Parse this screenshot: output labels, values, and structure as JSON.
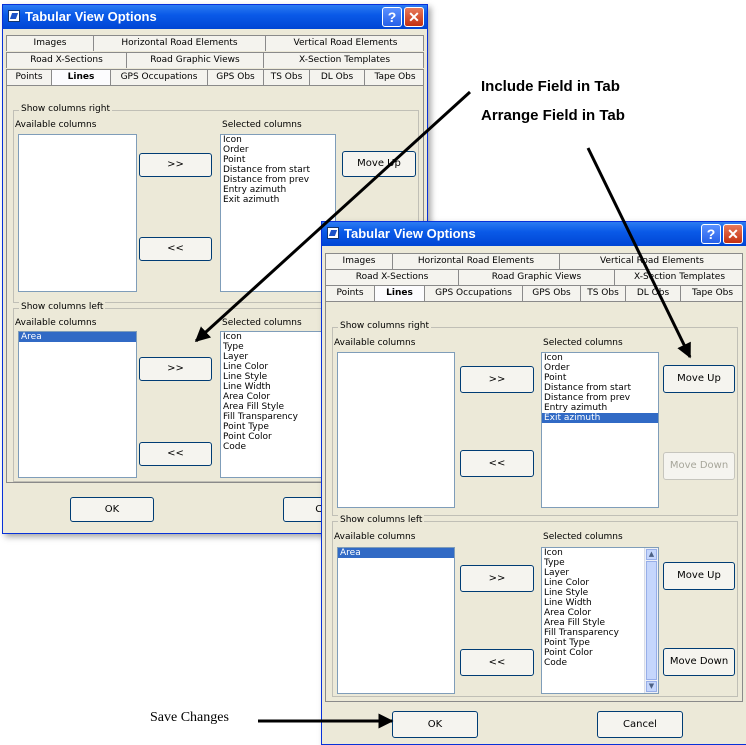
{
  "window_title": "Tabular View Options",
  "title_buttons": {
    "help": "?",
    "close": "✕"
  },
  "tabs": {
    "row1": [
      "Images",
      "Horizontal Road Elements",
      "Vertical Road Elements"
    ],
    "row2": [
      "Road X-Sections",
      "Road Graphic Views",
      "X-Section Templates"
    ],
    "row3": [
      "Points",
      "Lines",
      "GPS Occupations",
      "GPS Obs",
      "TS Obs",
      "DL Obs",
      "Tape Obs"
    ],
    "active": "Lines"
  },
  "right_group": {
    "label": "Show columns right",
    "available_label": "Available columns",
    "available": [],
    "selected_label": "Selected columns",
    "selected": [
      "Icon",
      "Order",
      "Point",
      "Distance from start",
      "Distance from prev",
      "Entry azimuth",
      "Exit azimuth"
    ],
    "add_button": ">>",
    "remove_button": "<<",
    "move_up": "Move Up",
    "move_down": "Move Down"
  },
  "left_group": {
    "label": "Show columns left",
    "available_label": "Available columns",
    "available": [
      "Area"
    ],
    "selected_label": "Selected columns",
    "selected": [
      "Icon",
      "Type",
      "Layer",
      "Line Color",
      "Line Style",
      "Line Width",
      "Area Color",
      "Area Fill Style",
      "Fill Transparency",
      "Point Type",
      "Point Color",
      "Code"
    ],
    "add_button": ">>",
    "remove_button": "<<",
    "move_up": "Move Up",
    "move_down": "Move Down"
  },
  "ok_button": "OK",
  "cancel_button": "Cancel",
  "back_window": {
    "cancel_fragment": "Can",
    "move_up_fragment": "Move Up"
  },
  "callouts": {
    "include": "Include Field in Tab",
    "arrange": "Arrange Field in Tab",
    "save": "Save Changes"
  },
  "colors": {
    "titlebar": "#0a5ae8",
    "selection": "#316ac5",
    "window_bg": "#ece9d8"
  }
}
